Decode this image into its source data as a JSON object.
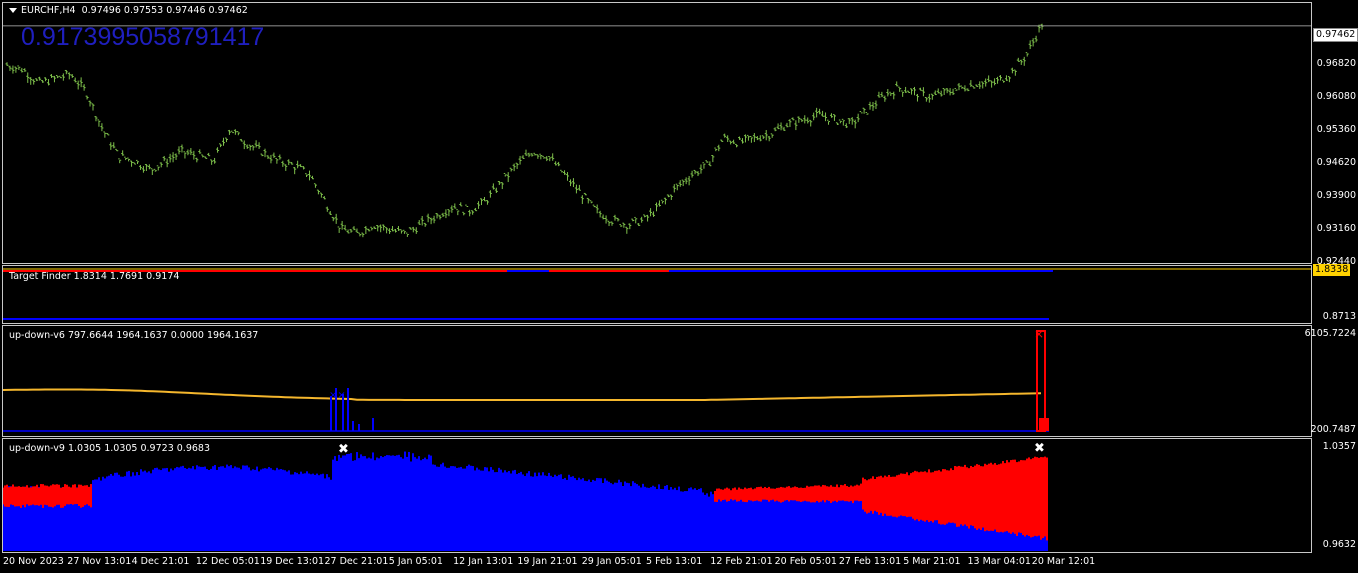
{
  "main": {
    "symbol_label": "EURCHF,H4",
    "ohlc": "0.97496 0.97553 0.97446 0.97462",
    "overlay_value": "0.9173995058791417",
    "current_price": "0.97462",
    "price_ticks": [
      "0.9682 ",
      "0.96080",
      "0.95360",
      "0.94620",
      "0.93900",
      "0.93160",
      "0.92440"
    ],
    "price_ticks_exact": [
      "0.96820",
      "0.96080",
      "0.95360",
      "0.94620",
      "0.93900",
      "0.93160",
      "0.92440"
    ],
    "candle_color": "#7ec04b"
  },
  "target_finder": {
    "title": "Target Finder 1.8314 1.7691 0.9174",
    "current_value": "1.8338",
    "top_tick": "1.8338",
    "bottom_tick": "0.8713",
    "colors": {
      "red": "#ff0000",
      "blue": "#0000ff",
      "yellow": "#ffd200"
    }
  },
  "updown_v6": {
    "title": "up-down-v6 797.6644 1964.1637 0.0000 1964.1637",
    "top_tick": "6105.7224",
    "bottom_tick": "200.7487",
    "line_color": "#f5b72d",
    "bar_colors": {
      "blue": "#0000ff",
      "red": "#ff0000"
    }
  },
  "updown_v9": {
    "title": "up-down-v9 1.0305 1.0305 0.9723 0.9683",
    "top_tick": "1.0357",
    "bottom_tick": "0.9632",
    "colors": {
      "blue": "#0000ff",
      "red": "#ff0000",
      "marker": "#ffffff"
    }
  },
  "time_axis": [
    "20 Nov 2023",
    "27 Nov 13:01",
    "4 Dec 21:01",
    "12 Dec 05:01",
    "19 Dec 13:01",
    "27 Dec 21:01",
    "5 Jan 05:01",
    "12 Jan 13:01",
    "19 Jan 21:01",
    "29 Jan 05:01",
    "5 Feb 13:01",
    "12 Feb 21:01",
    "20 Feb 05:01",
    "27 Feb 13:01",
    "5 Mar 21:01",
    "13 Mar 04:01",
    "20 Mar 12:01"
  ],
  "chart_data": {
    "type": "line",
    "title": "",
    "series": [
      {
        "x": [
          "20 Nov 2023",
          "27 Nov 13:01",
          "4 Dec 21:01",
          "12 Dec 05:01",
          "19 Dec 13:01",
          "27 Dec 21:01",
          "5 Jan 05:01",
          "12 Jan 13:01",
          "19 Jan 21:01",
          "29 Jan 05:01",
          "5 Feb 13:01",
          "12 Feb 21:01",
          "20 Feb 05:01",
          "27 Feb 13:01",
          "5 Mar 21:01",
          "13 Mar 04:01",
          "20 Mar 12:01"
        ],
        "values": [
          0.965,
          0.961,
          0.945,
          0.947,
          0.944,
          0.928,
          0.929,
          0.935,
          0.946,
          0.932,
          0.941,
          0.951,
          0.953,
          0.954,
          0.96,
          0.961,
          0.975
        ]
      }
    ],
    "ylim": [
      0.9244,
      0.977
    ]
  }
}
